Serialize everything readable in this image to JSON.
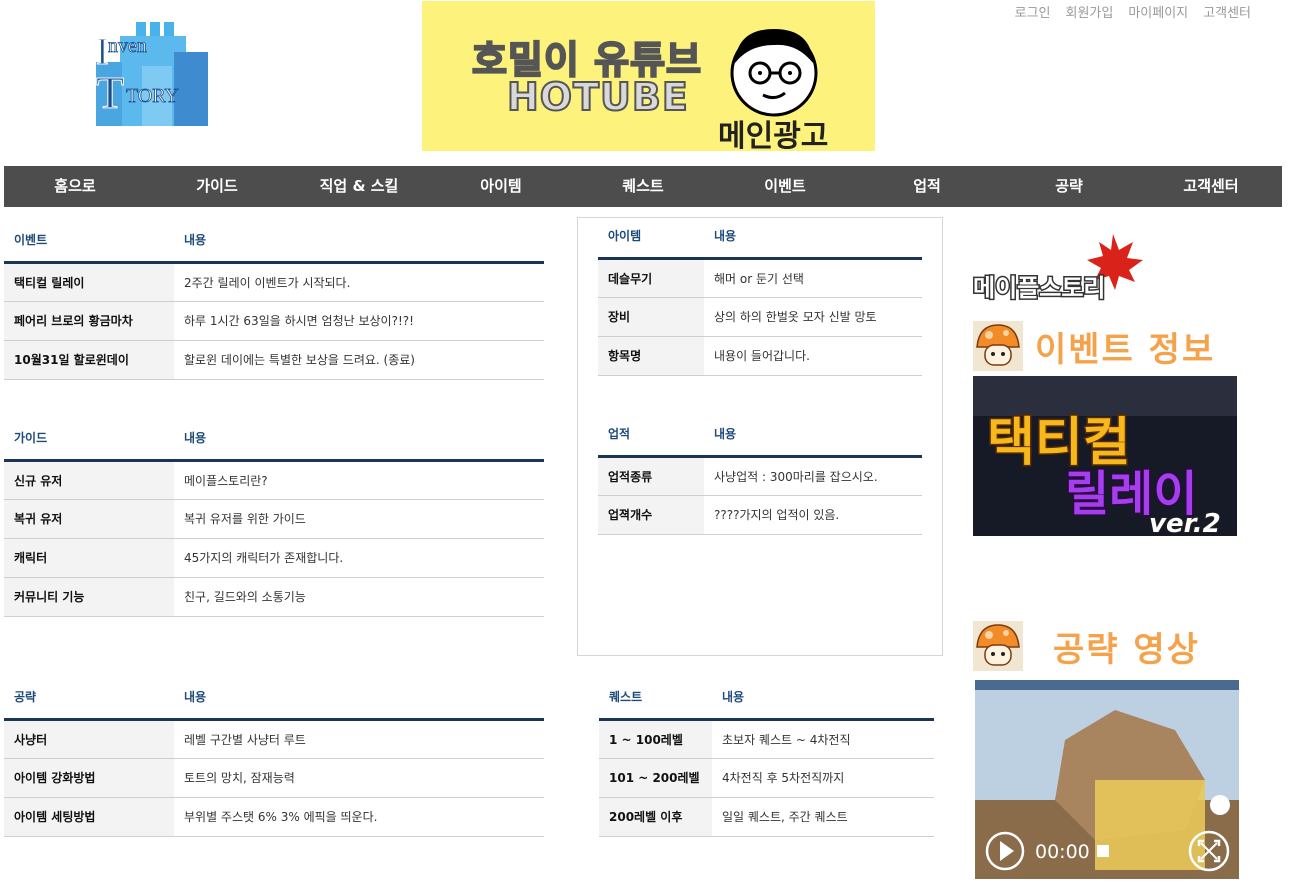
{
  "top_links": [
    "로그인",
    "회원가입",
    "마이페이지",
    "고객센터"
  ],
  "logo": {
    "text_top": "nven",
    "text_bottom": "TORY",
    "letters": "I"
  },
  "banner": {
    "line1": "호밀이 유튜브",
    "line2": "HOTUBE",
    "line3": "메인광고"
  },
  "nav": [
    "홈으로",
    "가이드",
    "직업 & 스킬",
    "아이템",
    "퀘스트",
    "이벤트",
    "업적",
    "공략",
    "고객센터"
  ],
  "tables": {
    "event": {
      "head": [
        "이벤트",
        "내용"
      ],
      "rows": [
        [
          "택티컬 릴레이",
          "2주간 릴레이 이벤트가 시작되다."
        ],
        [
          "페어리 브로의 황금마차",
          "하루 1시간 63일을 하시면 엄청난 보상이?!?!"
        ],
        [
          "10월31일 할로윈데이",
          "할로윈 데이에는 특별한 보상을 드려요. (종료)"
        ]
      ]
    },
    "guide": {
      "head": [
        "가이드",
        "내용"
      ],
      "rows": [
        [
          "신규 유저",
          "메이플스토리란?"
        ],
        [
          "복귀 유저",
          "복귀 유저를 위한 가이드"
        ],
        [
          "캐릭터",
          "45가지의 캐릭터가 존재합니다."
        ],
        [
          "커뮤니티 기능",
          "친구, 길드와의 소통기능"
        ]
      ]
    },
    "strategy": {
      "head": [
        "공략",
        "내용"
      ],
      "rows": [
        [
          "사냥터",
          "레벨 구간별 사냥터 루트"
        ],
        [
          "아이템 강화방법",
          "토트의 망치, 잠재능력"
        ],
        [
          "아이템 세팅방법",
          "부위별 주스탯 6% 3% 에픽을 띄운다."
        ]
      ]
    },
    "item": {
      "head": [
        "아이템",
        "내용"
      ],
      "rows": [
        [
          "데슬무기",
          "해머 or 둔기 선택"
        ],
        [
          "장비",
          "상의 하의 한벌옷 모자 신발 망토"
        ],
        [
          "항목명",
          "내용이 들어갑니다."
        ]
      ]
    },
    "achievement": {
      "head": [
        "업적",
        "내용"
      ],
      "rows": [
        [
          "업적종류",
          "사냥업적 : 300마리를 잡으시오."
        ],
        [
          "업젹개수",
          "????가지의 업적이 있음."
        ]
      ]
    },
    "quest": {
      "head": [
        "퀘스트",
        "내용"
      ],
      "rows": [
        [
          "1 ~ 100레벨",
          "초보자 퀘스트 ~ 4차전직"
        ],
        [
          "101 ~ 200레벨",
          "4차전직 후 5차전직까지"
        ],
        [
          "200레벨 이후",
          "일일 퀘스트, 주간 퀘스트"
        ]
      ]
    }
  },
  "right": {
    "maple_logo": "메이플스토리",
    "event_title": "이벤트 정보",
    "event_image": {
      "line1": "택티컬",
      "line2": "릴레이",
      "line3": "ver.2"
    },
    "video_title": "공략 영상",
    "video_time": "00:00"
  },
  "colors": {
    "nav_bg": "#4d4d4d",
    "header_text": "#1d4a7a",
    "header_border": "#1b3558",
    "accent": "#f6a24a",
    "banner_bg": "#fdf37c"
  }
}
